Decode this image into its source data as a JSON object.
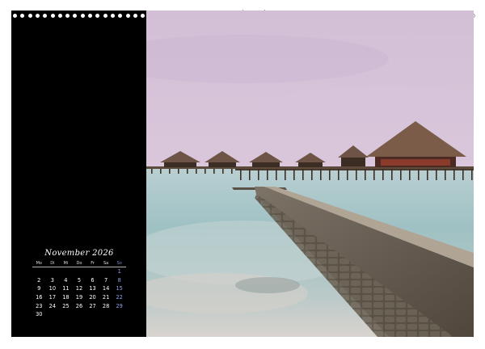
{
  "calendar": {
    "title": "November 2026",
    "weekdays": [
      "Mo",
      "Di",
      "Mi",
      "Do",
      "Fr",
      "Sa",
      "So"
    ],
    "weeks": [
      [
        "",
        "",
        "",
        "",
        "",
        "",
        "1"
      ],
      [
        "2",
        "3",
        "4",
        "5",
        "6",
        "7",
        "8"
      ],
      [
        "9",
        "10",
        "11",
        "12",
        "13",
        "14",
        "15"
      ],
      [
        "16",
        "17",
        "18",
        "19",
        "20",
        "21",
        "22"
      ],
      [
        "23",
        "24",
        "25",
        "26",
        "27",
        "28",
        "29"
      ],
      [
        "30",
        "",
        "",
        "",
        "",
        "",
        ""
      ]
    ]
  },
  "photo": {
    "subject": "Overwater bungalows on a pier above a calm lagoon at dusk, with a stone jetty in the foreground"
  },
  "colors": {
    "panel": "#000000",
    "sunday": "#8fa0e8",
    "sky_top": "#d6c2d8",
    "water": "#a9c7c8"
  }
}
